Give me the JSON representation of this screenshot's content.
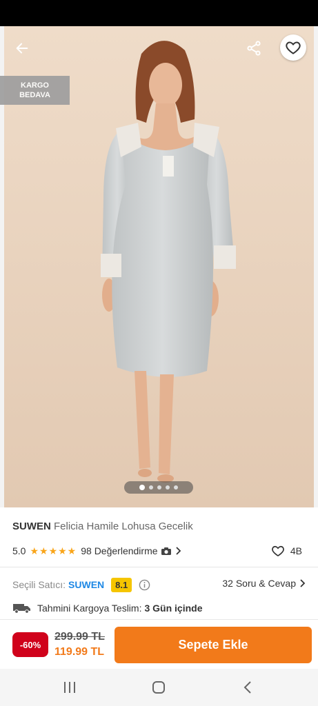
{
  "header": {
    "back_icon": "arrow-left-icon",
    "share_icon": "share-icon",
    "favorite_icon": "heart-outline-icon"
  },
  "badge": {
    "line1": "KARGO",
    "line2": "BEDAVA"
  },
  "gallery": {
    "image_count": 5,
    "active_index": 0
  },
  "product": {
    "brand": "SUWEN",
    "name": "Felicia Hamile Lohusa Gecelik",
    "rating": "5.0",
    "stars": "★★★★★",
    "star_count": 5,
    "reviews": "98 Değerlendirme",
    "favorites": "4B"
  },
  "seller": {
    "label": "Seçili Satıcı:",
    "name": "SUWEN",
    "score": "8.1",
    "qa": "32 Soru & Cevap"
  },
  "shipping": {
    "label": "Tahmini Kargoya Teslim:",
    "value": "3 Gün içinde"
  },
  "price": {
    "discount": "-60%",
    "old": "299.99 TL",
    "new": "119.99 TL"
  },
  "cta": {
    "label": "Sepete Ekle"
  },
  "colors": {
    "accent": "#f27a1a",
    "discount": "#d0021b",
    "seller_link": "#1e88e5",
    "stars": "#f9a51a",
    "score_bg": "#f5c500"
  },
  "navbar": {
    "icons": [
      "recent-apps-icon",
      "home-icon",
      "back-icon"
    ]
  }
}
